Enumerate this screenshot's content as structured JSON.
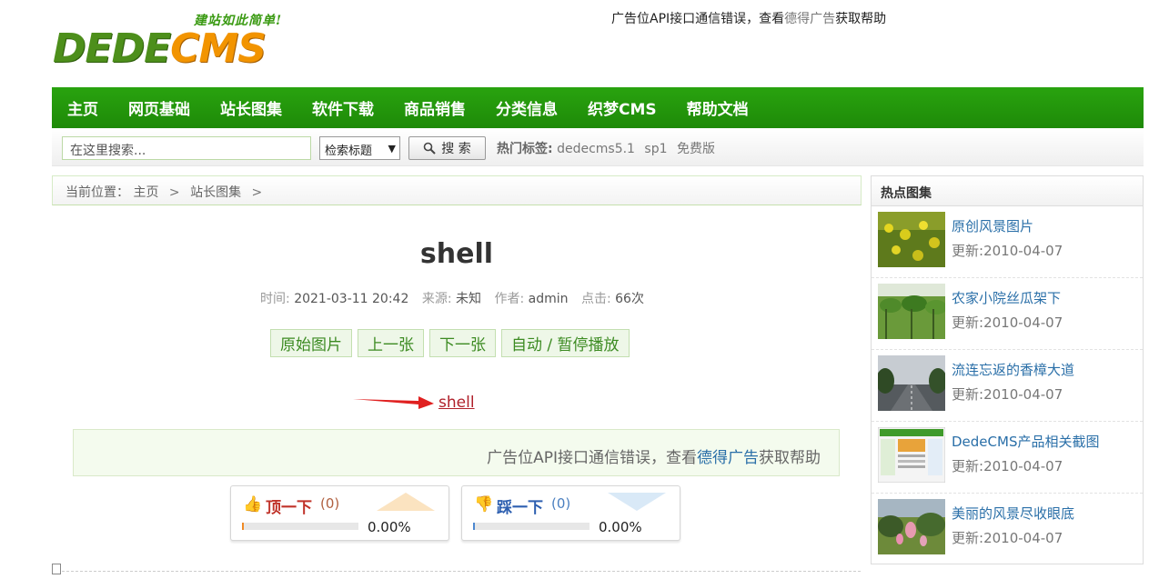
{
  "header": {
    "logo_slogan": "建站如此简单!",
    "logo_part1": "DEDE",
    "logo_part2": "CMS",
    "ad_prefix": "广告位API接口通信错误，查看",
    "ad_link": "德得广告",
    "ad_suffix": "获取帮助"
  },
  "nav": {
    "items": [
      "主页",
      "网页基础",
      "站长图集",
      "软件下载",
      "商品销售",
      "分类信息",
      "织梦CMS",
      "帮助文档"
    ]
  },
  "search": {
    "placeholder": "在这里搜索...",
    "select_value": "检索标题",
    "button_label": "搜 索",
    "hot_label": "热门标签:",
    "hot_tags": [
      "dedecms5.1",
      "sp1",
      "免费版"
    ]
  },
  "breadcrumb": {
    "label": "当前位置：",
    "items": [
      "主页",
      "站长图集"
    ]
  },
  "article": {
    "title": "shell",
    "time_label": "时间:",
    "time_value": "2021-03-11 20:42",
    "source_label": "来源:",
    "source_value": "未知",
    "author_label": "作者:",
    "author_value": "admin",
    "clicks_label": "点击:",
    "clicks_value": "66次",
    "buttons": [
      "原始图片",
      "上一张",
      "下一张",
      "自动 / 暂停播放"
    ],
    "image_link": "shell",
    "ad_prefix": "广告位API接口通信错误，查看",
    "ad_link": "德得广告",
    "ad_suffix": "获取帮助"
  },
  "votes": {
    "up": {
      "label": "顶一下",
      "count": "(0)",
      "percent": "0.00%",
      "fraction": 0
    },
    "down": {
      "label": "踩一下",
      "count": "(0)",
      "percent": "0.00%",
      "fraction": 0
    }
  },
  "sidebar": {
    "title": "热点图集",
    "date_label": "更新:",
    "items": [
      {
        "name": "原创风景图片",
        "date": "2010-04-07"
      },
      {
        "name": "农家小院丝瓜架下",
        "date": "2010-04-07"
      },
      {
        "name": "流连忘返的香樟大道",
        "date": "2010-04-07"
      },
      {
        "name": "DedeCMS产品相关截图",
        "date": "2010-04-07"
      },
      {
        "name": "美丽的风景尽收眼底",
        "date": "2010-04-07"
      }
    ]
  },
  "colors": {
    "nav_green": "#1e8a08",
    "link_blue": "#2a6fa8",
    "link_red": "#b0202a",
    "up_red": "#c0332a",
    "down_blue": "#2d5fb0"
  }
}
